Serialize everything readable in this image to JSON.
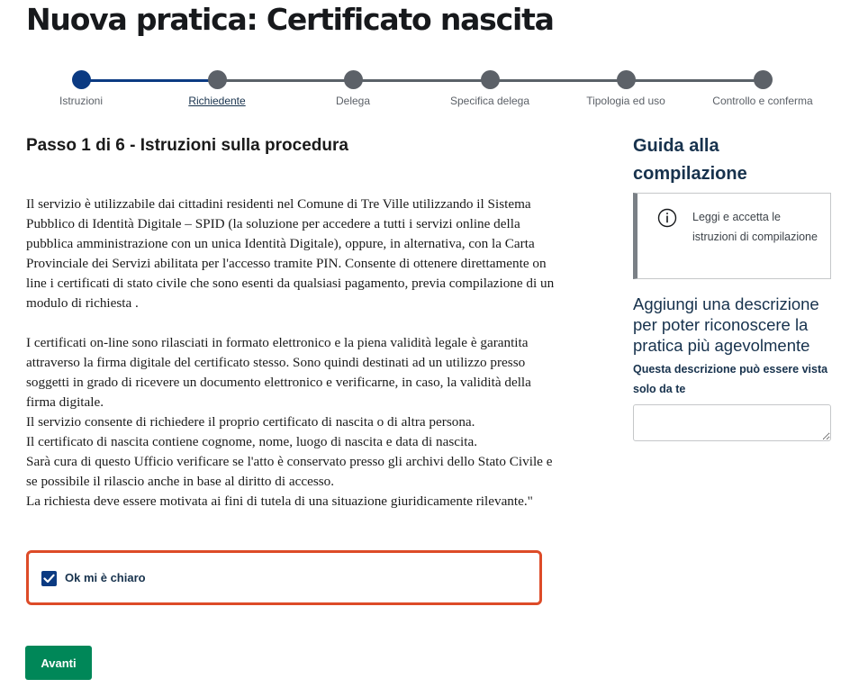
{
  "page": {
    "title": "Nuova pratica: Certificato nascita"
  },
  "stepper": {
    "steps": [
      {
        "label": "Istruzioni",
        "state": "active"
      },
      {
        "label": "Richiedente",
        "state": "current"
      },
      {
        "label": "Delega",
        "state": "pending"
      },
      {
        "label": "Specifica delega",
        "state": "pending"
      },
      {
        "label": "Tipologia ed uso",
        "state": "pending"
      },
      {
        "label": "Controllo e conferma",
        "state": "pending"
      }
    ],
    "completed_color": "#0b3a82",
    "pending_color": "#5c6168"
  },
  "main": {
    "heading": "Passo 1 di 6 - Istruzioni sulla procedura",
    "paragraph1": "Il servizio è utilizzabile dai cittadini residenti nel Comune di Tre Ville utilizzando il Sistema Pubblico di Identità Digitale – SPID (la soluzione per accedere a tutti i servizi online della pubblica amministrazione con un unica Identità Digitale), oppure, in alternativa, con la Carta Provinciale dei Servizi abilitata per l'accesso tramite PIN. Consente di ottenere direttamente on line i certificati di stato civile che sono esenti da qualsiasi pagamento, previa compilazione di un modulo di richiesta .",
    "paragraph2": "I certificati on-line sono rilasciati in formato elettronico e la piena validità legale è garantita attraverso la firma digitale del certificato stesso. Sono quindi destinati ad un utilizzo presso soggetti in grado di ricevere un documento elettronico e verificarne, in caso, la validità della firma digitale.",
    "paragraph3": "Il servizio consente di richiedere il proprio certificato di nascita o di altra persona.",
    "paragraph4": "Il certificato di nascita contiene cognome, nome, luogo di nascita e data di nascita.",
    "paragraph5": "Sarà cura di questo Ufficio verificare se l'atto è conservato presso gli archivi dello Stato Civile e se possibile il rilascio anche in base al diritto di accesso.",
    "paragraph6": "La richiesta deve essere motivata ai fini di tutela di una situazione giuridicamente rilevante.\"",
    "confirm": {
      "label": "Ok mi è chiaro",
      "checked": true,
      "highlight_color": "#dd4b28"
    },
    "next_button": "Avanti",
    "next_button_color": "#008758"
  },
  "sidebar": {
    "guide_title": "Guida alla compilazione",
    "guide_icon": "info-circle-icon",
    "guide_text": "Leggi e accetta le istruzioni di compilazione",
    "description_title": "Aggiungi una descrizione per poter riconoscere la pratica più agevolmente",
    "description_subtitle": "Questa descrizione può essere vista solo da te",
    "description_value": ""
  }
}
